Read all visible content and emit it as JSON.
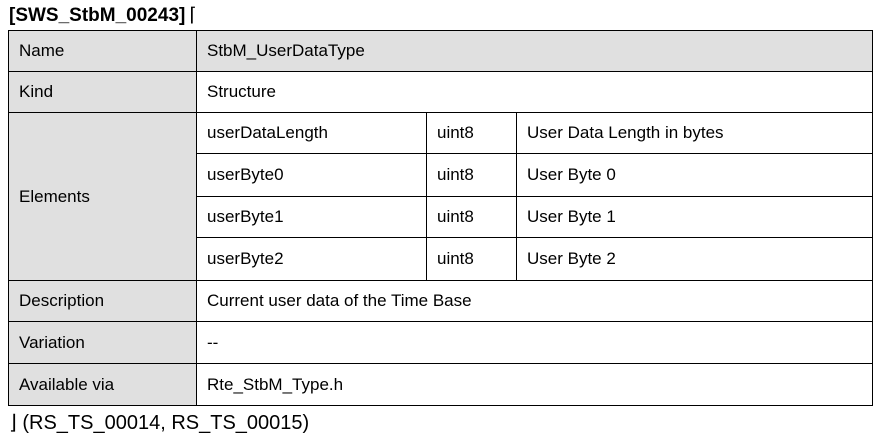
{
  "requirement": {
    "id": "[SWS_StbM_00243]",
    "open_bracket": "⌈",
    "close_trace": "⌋ (RS_TS_00014, RS_TS_00015)"
  },
  "table": {
    "name_label": "Name",
    "name_value": "StbM_UserDataType",
    "kind_label": "Kind",
    "kind_value": "Structure",
    "elements_label": "Elements",
    "elements": [
      {
        "name": "userDataLength",
        "type": "uint8",
        "comment": "User Data Length in bytes"
      },
      {
        "name": "userByte0",
        "type": "uint8",
        "comment": "User Byte 0"
      },
      {
        "name": "userByte1",
        "type": "uint8",
        "comment": "User Byte 1"
      },
      {
        "name": "userByte2",
        "type": "uint8",
        "comment": "User Byte 2"
      }
    ],
    "description_label": "Description",
    "description_value": "Current user data of the Time Base",
    "variation_label": "Variation",
    "variation_value": "--",
    "available_label": "Available via",
    "available_value": "Rte_StbM_Type.h"
  }
}
